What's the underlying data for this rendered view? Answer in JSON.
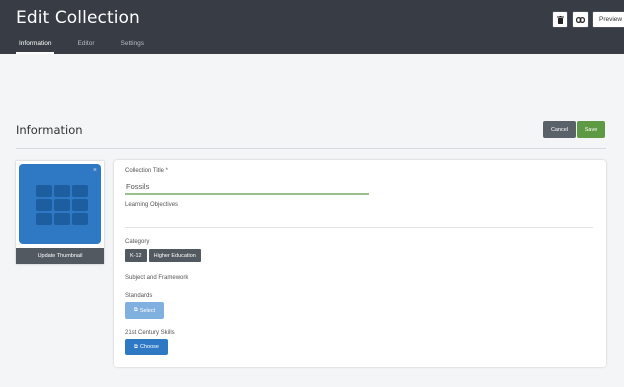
{
  "header": {
    "title": "Edit Collection",
    "tabs": [
      {
        "label": "Information",
        "active": true
      },
      {
        "label": "Editor",
        "active": false
      },
      {
        "label": "Settings",
        "active": false
      }
    ],
    "toolbar": {
      "delete_icon": "trash-icon",
      "link_icon": "link-icon",
      "preview_label": "Preview"
    }
  },
  "section": {
    "title": "Information",
    "cancel_label": "Cancel",
    "save_label": "Save"
  },
  "thumbnail": {
    "remove_icon": "×",
    "update_label": "Update Thumbnail"
  },
  "form": {
    "title_label": "Collection Title *",
    "title_value": "Fossils",
    "objectives_label": "Learning Objectives",
    "category_label": "Category",
    "categories": [
      "K-12",
      "Higher Education"
    ],
    "subject_label": "Subject and Framework",
    "standards_label": "Standards",
    "select_label": "Select",
    "skills_label": "21st Century Skills",
    "choose_label": "Choose"
  },
  "colors": {
    "header_bg": "#383d45",
    "save": "#5e9a43",
    "thumbnail_bg": "#2f78c4",
    "select_btn": "#7fb0e0",
    "choose_btn": "#2f78c4"
  }
}
